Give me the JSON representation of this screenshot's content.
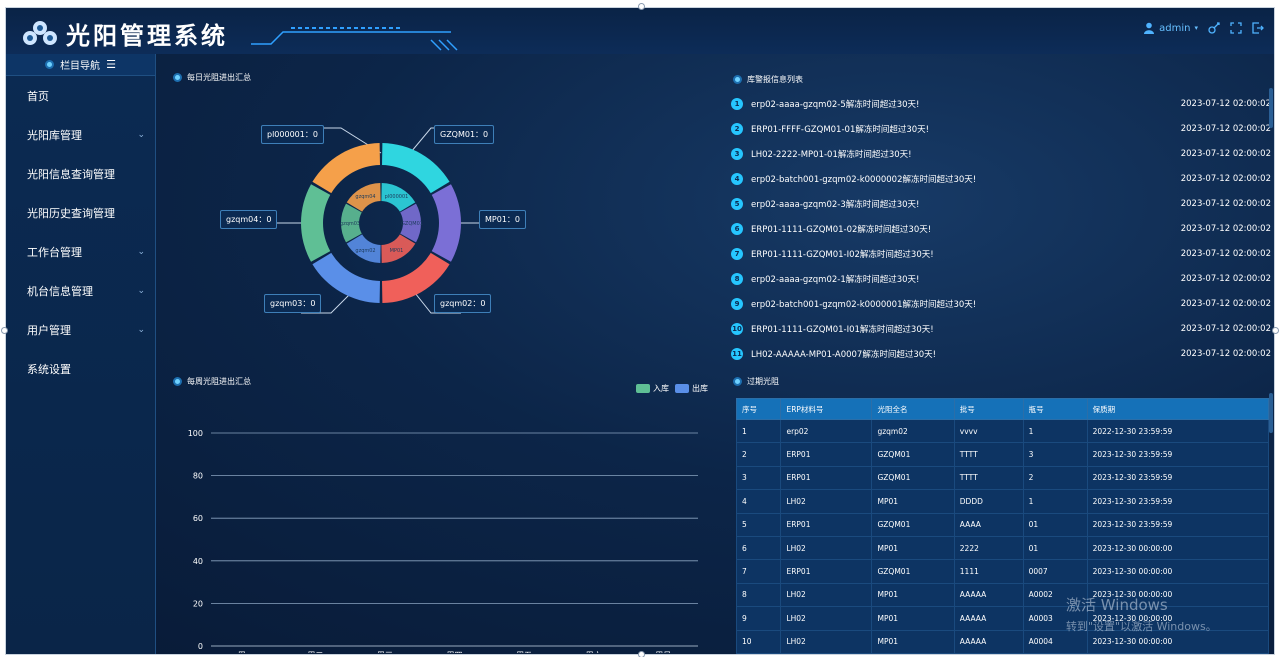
{
  "header": {
    "title": "光阳管理系统",
    "user": "admin",
    "icons": [
      "user-icon",
      "chevron-down-icon",
      "key-icon",
      "fullscreen-icon",
      "logout-icon"
    ]
  },
  "sidebar": {
    "heading": "栏目导航",
    "items": [
      {
        "label": "首页",
        "has_children": false
      },
      {
        "label": "光阳库管理",
        "has_children": true
      },
      {
        "label": "光阳信息查询管理",
        "has_children": false
      },
      {
        "label": "光阳历史查询管理",
        "has_children": false
      },
      {
        "label": "工作台管理",
        "has_children": true
      },
      {
        "label": "机台信息管理",
        "has_children": true
      },
      {
        "label": "用户管理",
        "has_children": true
      },
      {
        "label": "系统设置",
        "has_children": false
      }
    ]
  },
  "daily_panel": {
    "title": "每日光阻进出汇总",
    "labels": {
      "pl": "pl000001：0",
      "gzqm01": "GZQM01：0",
      "mp01": "MP01：0",
      "gzqm02": "gzqm02：0",
      "gzqm03": "gzqm03：0",
      "gzqm04": "gzqm04：0"
    },
    "inner_labels": [
      "pl000001",
      "GZQM01",
      "MP01",
      "gzqm02",
      "gzqm03",
      "gzqm04"
    ]
  },
  "weekly_panel": {
    "title": "每周光阻进出汇总"
  },
  "warning_panel": {
    "title": "库警报信息列表",
    "items": [
      {
        "num": "1",
        "text": "erp02-aaaa-gzqm02-5解冻时间超过30天!",
        "time": "2023-07-12 02:00:02"
      },
      {
        "num": "2",
        "text": "ERP01-FFFF-GZQM01-01解冻时间超过30天!",
        "time": "2023-07-12 02:00:02"
      },
      {
        "num": "3",
        "text": "LH02-2222-MP01-01解冻时间超过30天!",
        "time": "2023-07-12 02:00:02"
      },
      {
        "num": "4",
        "text": "erp02-batch001-gzqm02-k0000002解冻时间超过30天!",
        "time": "2023-07-12 02:00:02"
      },
      {
        "num": "5",
        "text": "erp02-aaaa-gzqm02-3解冻时间超过30天!",
        "time": "2023-07-12 02:00:02"
      },
      {
        "num": "6",
        "text": "ERP01-1111-GZQM01-02解冻时间超过30天!",
        "time": "2023-07-12 02:00:02"
      },
      {
        "num": "7",
        "text": "ERP01-1111-GZQM01-I02解冻时间超过30天!",
        "time": "2023-07-12 02:00:02"
      },
      {
        "num": "8",
        "text": "erp02-aaaa-gzqm02-1解冻时间超过30天!",
        "time": "2023-07-12 02:00:02"
      },
      {
        "num": "9",
        "text": "erp02-batch001-gzqm02-k0000001解冻时间超过30天!",
        "time": "2023-07-12 02:00:02"
      },
      {
        "num": "10",
        "text": "ERP01-1111-GZQM01-I01解冻时间超过30天!",
        "time": "2023-07-12 02:00:02"
      },
      {
        "num": "11",
        "text": "LH02-AAAAA-MP01-A0007解冻时间超过30天!",
        "time": "2023-07-12 02:00:02"
      }
    ]
  },
  "expired_panel": {
    "title": "过期光阻",
    "columns": [
      "序号",
      "ERP材料号",
      "光阻全名",
      "批号",
      "瓶号",
      "保质期"
    ],
    "rows": [
      [
        "1",
        "erp02",
        "gzqm02",
        "vvvv",
        "1",
        "2022-12-30 23:59:59"
      ],
      [
        "2",
        "ERP01",
        "GZQM01",
        "TTTT",
        "3",
        "2023-12-30 23:59:59"
      ],
      [
        "3",
        "ERP01",
        "GZQM01",
        "TTTT",
        "2",
        "2023-12-30 23:59:59"
      ],
      [
        "4",
        "LH02",
        "MP01",
        "DDDD",
        "1",
        "2023-12-30 23:59:59"
      ],
      [
        "5",
        "ERP01",
        "GZQM01",
        "AAAA",
        "01",
        "2023-12-30 23:59:59"
      ],
      [
        "6",
        "LH02",
        "MP01",
        "2222",
        "01",
        "2023-12-30 00:00:00"
      ],
      [
        "7",
        "ERP01",
        "GZQM01",
        "1111",
        "0007",
        "2023-12-30 00:00:00"
      ],
      [
        "8",
        "LH02",
        "MP01",
        "AAAAA",
        "A0002",
        "2023-12-30 00:00:00"
      ],
      [
        "9",
        "LH02",
        "MP01",
        "AAAAA",
        "A0003",
        "2023-12-30 00:00:00"
      ],
      [
        "10",
        "LH02",
        "MP01",
        "AAAAA",
        "A0004",
        "2023-12-30 00:00:00"
      ]
    ]
  },
  "watermark": {
    "line1": "激活 Windows",
    "line2": "转到\"设置\"以激活 Windows。"
  },
  "colors": {
    "teal": "#2fd6e0",
    "purple": "#7b6fd6",
    "coral": "#f0605a",
    "blue": "#5a8fe8",
    "green": "#5fbf95",
    "orange": "#f5a04a"
  },
  "chart_data": [
    {
      "type": "pie",
      "categories": [
        "pl000001",
        "GZQM01",
        "MP01",
        "gzqm02",
        "gzqm03",
        "gzqm04"
      ],
      "values": [
        0,
        0,
        0,
        0,
        0,
        0
      ]
    },
    {
      "type": "bar",
      "categories": [
        "周一",
        "周二",
        "周三",
        "周四",
        "周五",
        "周六",
        "周日"
      ],
      "series": [
        {
          "name": "入库",
          "values": [
            0,
            0,
            0,
            0,
            0,
            0,
            0
          ],
          "color": "#5fbf95"
        },
        {
          "name": "出库",
          "values": [
            0,
            0,
            0,
            0,
            0,
            0,
            0
          ],
          "color": "#5a8fe8"
        }
      ],
      "ylim": [
        0,
        100
      ],
      "yticks": [
        0,
        20,
        40,
        60,
        80,
        100
      ],
      "legend": "top-right",
      "grid": true
    }
  ]
}
